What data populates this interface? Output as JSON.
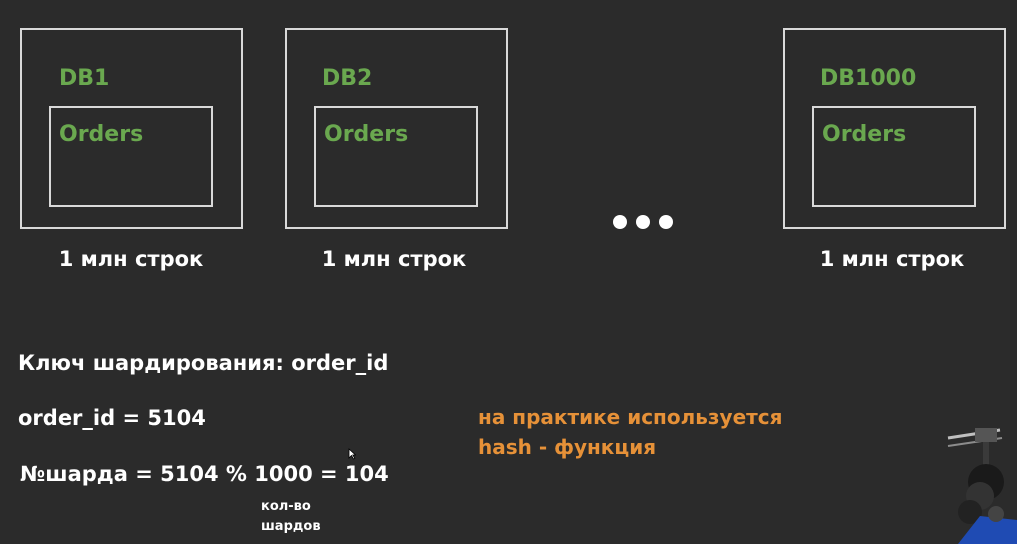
{
  "databases": [
    {
      "name": "DB1",
      "table": "Orders",
      "rows": "1 млн строк"
    },
    {
      "name": "DB2",
      "table": "Orders",
      "rows": "1 млн строк"
    },
    {
      "name": "DB1000",
      "table": "Orders",
      "rows": "1 млн строк"
    }
  ],
  "sharding_key_line": "Ключ шардирования: order_id",
  "order_id_line": "order_id = 5104",
  "shard_formula_line": "№шарда = 5104 % 1000 = 104",
  "note": [
    "кол-во",
    "шардов"
  ],
  "practice_note": [
    "на практике используется",
    "hash - функция"
  ],
  "colors": {
    "background": "#2b2b2b",
    "db_label": "#6aa84f",
    "practice_note": "#e69138",
    "box_border": "#d9d9d9"
  }
}
